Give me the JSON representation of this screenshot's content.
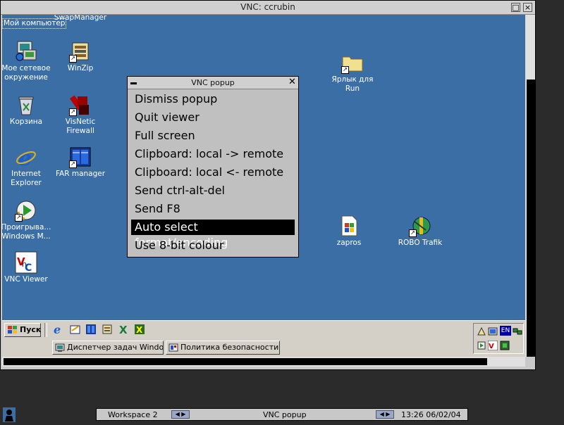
{
  "window": {
    "title": "VNC: ccrubin"
  },
  "desktop_icons": [
    {
      "label": "Мой компьютер",
      "name": "my-computer-icon"
    },
    {
      "label": "SwapManager",
      "name": "swapmanager-icon"
    },
    {
      "label": "Мое сетевое окружение",
      "name": "network-places-icon"
    },
    {
      "label": "WinZip",
      "name": "winzip-icon"
    },
    {
      "label": "Корзина",
      "name": "recycle-bin-icon"
    },
    {
      "label": "VisNetic Firewall",
      "name": "visnetic-firewall-icon"
    },
    {
      "label": "Internet Explorer",
      "name": "internet-explorer-icon"
    },
    {
      "label": "FAR manager",
      "name": "far-manager-icon"
    },
    {
      "label": "Проигрыва... Windows M...",
      "name": "windows-media-player-icon"
    },
    {
      "label": "VNC Viewer",
      "name": "vnc-viewer-icon"
    },
    {
      "label": "Ярлык для Run",
      "name": "run-shortcut-folder-icon"
    },
    {
      "label": "zapros",
      "name": "zapros-icon"
    },
    {
      "label": "ROBO Trafik",
      "name": "robo-trafik-icon"
    }
  ],
  "taskbar": {
    "start_label": "Пуск",
    "tasks": [
      "Диспетчер задач Windows",
      "Политика безопасности ..."
    ],
    "tray_lang": "EN"
  },
  "popup": {
    "title": "VNC popup",
    "items": [
      "Dismiss popup",
      "Quit viewer",
      "Full screen",
      "Clipboard: local -> remote",
      "Clipboard: local <- remote",
      "Send ctrl-alt-del",
      "Send F8",
      "Auto select format/encoding",
      "Use 8-bit colour"
    ],
    "selected_index": 7
  },
  "bottombar": {
    "workspace": "Workspace 2",
    "active_window": "VNC popup",
    "clock": "13:26 06/02/04"
  }
}
